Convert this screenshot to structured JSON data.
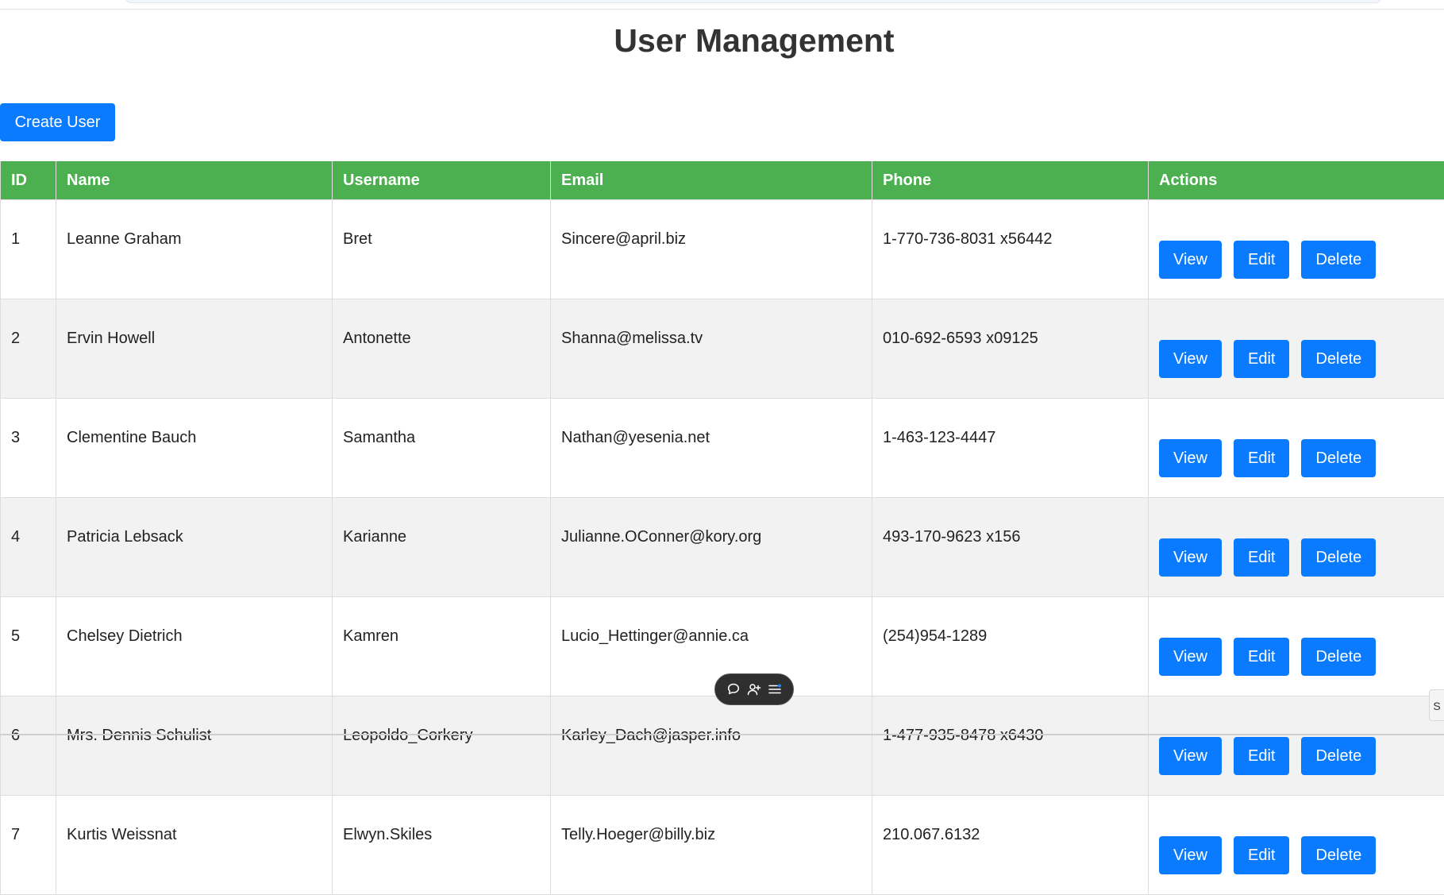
{
  "page": {
    "title": "User Management"
  },
  "toolbar": {
    "create_label": "Create User"
  },
  "table": {
    "headers": [
      "ID",
      "Name",
      "Username",
      "Email",
      "Phone",
      "Actions"
    ],
    "action_labels": {
      "view": "View",
      "edit": "Edit",
      "delete": "Delete"
    },
    "rows": [
      {
        "id": "1",
        "name": "Leanne Graham",
        "username": "Bret",
        "email": "Sincere@april.biz",
        "phone": "1-770-736-8031 x56442"
      },
      {
        "id": "2",
        "name": "Ervin Howell",
        "username": "Antonette",
        "email": "Shanna@melissa.tv",
        "phone": "010-692-6593 x09125"
      },
      {
        "id": "3",
        "name": "Clementine Bauch",
        "username": "Samantha",
        "email": "Nathan@yesenia.net",
        "phone": "1-463-123-4447"
      },
      {
        "id": "4",
        "name": "Patricia Lebsack",
        "username": "Karianne",
        "email": "Julianne.OConner@kory.org",
        "phone": "493-170-9623 x156"
      },
      {
        "id": "5",
        "name": "Chelsey Dietrich",
        "username": "Kamren",
        "email": "Lucio_Hettinger@annie.ca",
        "phone": "(254)954-1289"
      },
      {
        "id": "6",
        "name": "Mrs. Dennis Schulist",
        "username": "Leopoldo_Corkery",
        "email": "Karley_Dach@jasper.info",
        "phone": "1-477-935-8478 x6430"
      },
      {
        "id": "7",
        "name": "Kurtis Weissnat",
        "username": "Elwyn.Skiles",
        "email": "Telly.Hoeger@billy.biz",
        "phone": "210.067.6132"
      }
    ]
  },
  "floating_toolbar": {
    "icons": [
      "comment-icon",
      "add-user-icon",
      "list-icon"
    ],
    "accent_color": "#1e88ff"
  },
  "edge_tab": {
    "label": "S"
  },
  "colors": {
    "primary_button": "#0a7bff",
    "table_header": "#4caf50",
    "row_alt": "#f2f2f2"
  }
}
